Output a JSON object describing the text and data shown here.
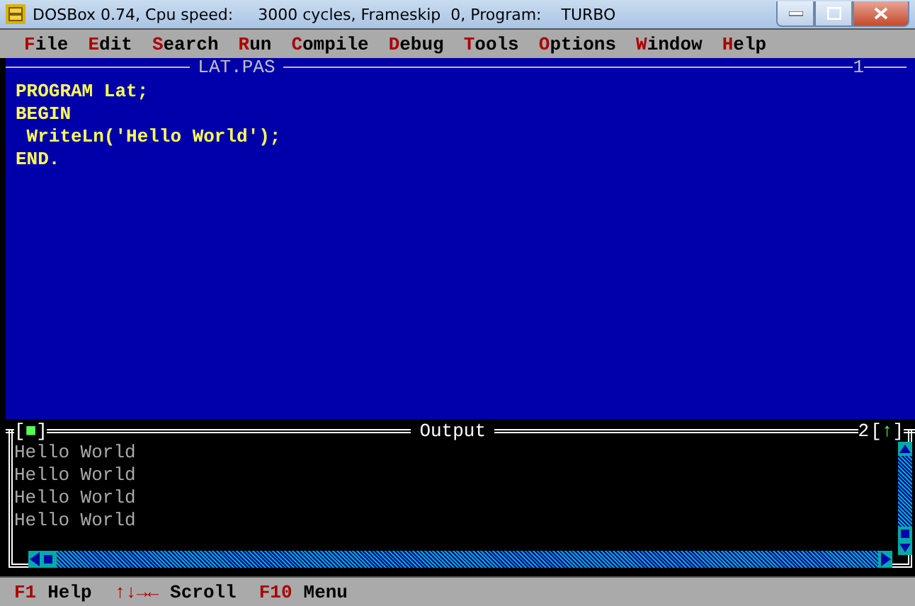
{
  "window": {
    "title": "DOSBox 0.74, Cpu speed:     3000 cycles, Frameskip  0, Program:    TURBO"
  },
  "menu": [
    "**F**ile",
    "**E**dit",
    "**S**earch",
    "**R**un",
    "**C**ompile",
    "**D**ebug",
    "**T**ools",
    "**O**ptions",
    "**W**indow",
    "**H**elp"
  ],
  "editor": {
    "title": "LAT.PAS",
    "number": "1",
    "active": false,
    "lines": [
      "PROGRAM Lat;",
      "BEGIN",
      " WriteLn('Hello World');",
      "END."
    ]
  },
  "output": {
    "title": "Output",
    "close": "[**■**]",
    "number": "2",
    "zoom": "[**↑**]",
    "active": true,
    "lines": [
      "Hello World",
      "Hello World",
      "Hello World",
      "Hello World"
    ]
  },
  "status_bar": [
    {
      "key": "F1",
      "label": "Help"
    },
    {
      "key": "↑↓→←",
      "label": "Scroll"
    },
    {
      "key": "F10",
      "label": "Menu"
    }
  ]
}
